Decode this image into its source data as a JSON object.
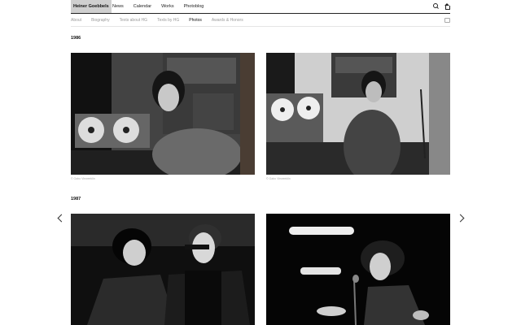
{
  "header": {
    "brand": "Heiner Goebbels",
    "nav": [
      "News",
      "Calendar",
      "Works",
      "Photoblog"
    ]
  },
  "subnav": {
    "items": [
      "About",
      "Biography",
      "Texts about HG",
      "Texts by HG",
      "Photos",
      "Awards & Honors"
    ],
    "active_index": 4
  },
  "sections": [
    {
      "year": "1986",
      "photos": [
        {
          "caption": "© Gabo Vieweeklin"
        },
        {
          "caption": "© Gabo Vieweeklin"
        }
      ]
    },
    {
      "year": "1987",
      "photos": [
        {
          "caption": ""
        },
        {
          "caption": ""
        }
      ]
    }
  ],
  "icons": {
    "search": "search-icon",
    "home": "home-icon",
    "subnav_right": "print-icon",
    "prev": "chevron-left-icon",
    "next": "chevron-right-icon"
  }
}
